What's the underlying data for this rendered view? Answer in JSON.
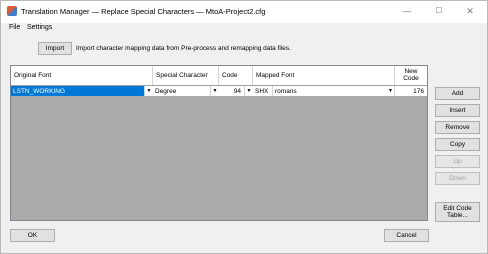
{
  "window": {
    "title": "Translation Manager — Replace Special Characters — MtoA-Project2.cfg",
    "minimize": "—",
    "maximize": "☐",
    "close": "✕"
  },
  "menu": [
    "File",
    "Settings"
  ],
  "import": {
    "button_label": "Import",
    "description": "Import character mapping data from Pre-process and remapping data files."
  },
  "grid": {
    "columns": [
      "Original Font",
      "Special Character",
      "Code",
      "Mapped Font",
      "New\nCode"
    ],
    "rows": [
      {
        "original_font": "LSTN_WORKING",
        "special_character": "Degree",
        "code": "94",
        "mapped_font_type": "SHX",
        "mapped_font_name": "romans",
        "new_code": "176"
      }
    ]
  },
  "side_buttons": {
    "add": "Add",
    "insert": "Insert",
    "remove": "Remove",
    "copy": "Copy",
    "up": "Up",
    "down": "Down",
    "edit_code_table": "Edit Code\nTable..."
  },
  "footer": {
    "ok": "OK",
    "cancel": "Cancel"
  },
  "icons": {
    "dropdown": "chevron-down-icon",
    "app": "app-icon"
  }
}
